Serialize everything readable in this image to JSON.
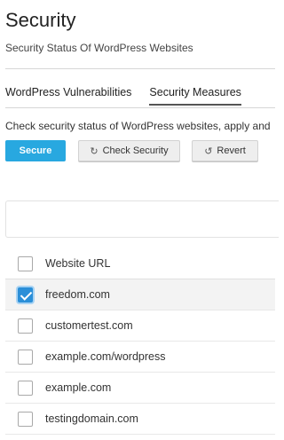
{
  "header": {
    "title": "Security",
    "subtitle": "Security Status Of WordPress Websites"
  },
  "tabs": [
    {
      "label": "WordPress Vulnerabilities",
      "active": false
    },
    {
      "label": "Security Measures",
      "active": true
    }
  ],
  "description": "Check security status of WordPress websites, apply and",
  "toolbar": {
    "secure_label": "Secure",
    "check_security_label": "Check Security",
    "revert_label": "Revert",
    "check_security_icon": "refresh-icon",
    "revert_icon": "revert-icon"
  },
  "table": {
    "header_label": "Website URL",
    "header_checked": false,
    "rows": [
      {
        "url": "freedom.com",
        "checked": true
      },
      {
        "url": "customertest.com",
        "checked": false
      },
      {
        "url": "example.com/wordpress",
        "checked": false
      },
      {
        "url": "example.com",
        "checked": false
      },
      {
        "url": "testingdomain.com",
        "checked": false
      }
    ]
  },
  "colors": {
    "primary_button": "#28a8e0",
    "checkbox_checked": "#2b8fd8"
  }
}
